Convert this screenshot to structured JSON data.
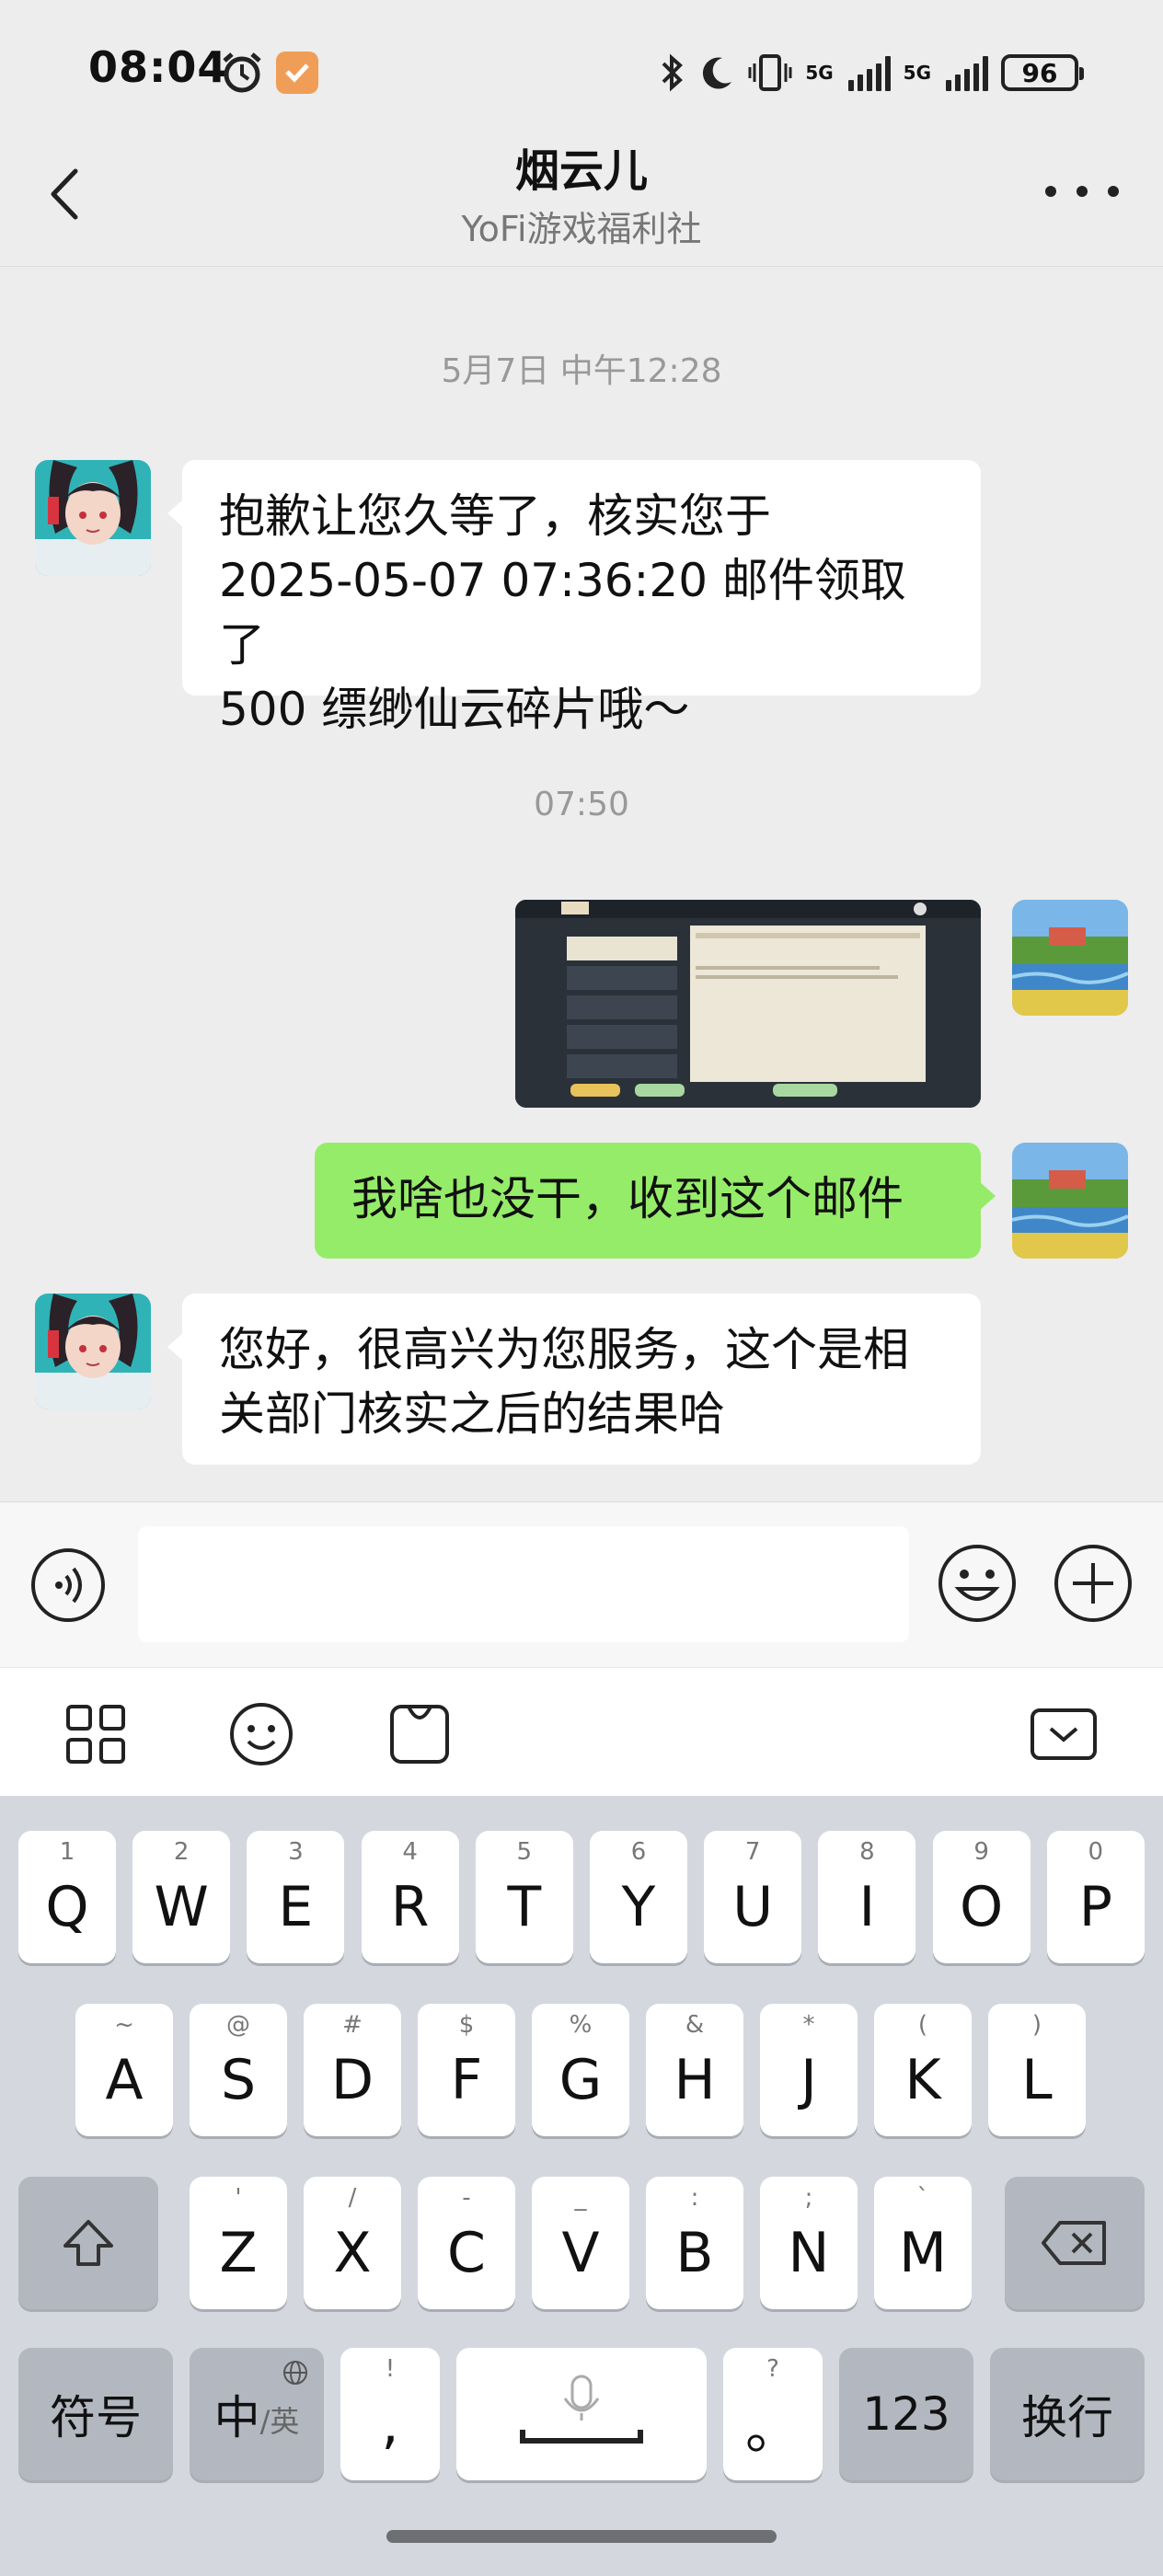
{
  "status_bar": {
    "time": "08:04",
    "network_left": "5G",
    "network_right": "5G",
    "battery": "96"
  },
  "header": {
    "title": "烟云儿",
    "subtitle": "YoFi游戏福利社"
  },
  "messages": {
    "ts1": "5月7日 中午12:28",
    "m1_line1": "抱歉让您久等了，核实您于",
    "m1_line2": "2025-05-07 07:36:20 邮件领取了",
    "m1_line3": "500 缥缈仙云碎片哦～",
    "ts2": "07:50",
    "m3": "我啥也没干，收到这个邮件",
    "m4_line1": "您好，很高兴为您服务，这个是相",
    "m4_line2": "关部门核实之后的结果哈"
  },
  "keyboard": {
    "row1": [
      {
        "hint": "1",
        "key": "Q"
      },
      {
        "hint": "2",
        "key": "W"
      },
      {
        "hint": "3",
        "key": "E"
      },
      {
        "hint": "4",
        "key": "R"
      },
      {
        "hint": "5",
        "key": "T"
      },
      {
        "hint": "6",
        "key": "Y"
      },
      {
        "hint": "7",
        "key": "U"
      },
      {
        "hint": "8",
        "key": "I"
      },
      {
        "hint": "9",
        "key": "O"
      },
      {
        "hint": "0",
        "key": "P"
      }
    ],
    "row2": [
      {
        "hint": "~",
        "key": "A"
      },
      {
        "hint": "@",
        "key": "S"
      },
      {
        "hint": "#",
        "key": "D"
      },
      {
        "hint": "$",
        "key": "F"
      },
      {
        "hint": "%",
        "key": "G"
      },
      {
        "hint": "&",
        "key": "H"
      },
      {
        "hint": "*",
        "key": "J"
      },
      {
        "hint": "(",
        "key": "K"
      },
      {
        "hint": ")",
        "key": "L"
      }
    ],
    "row3": [
      {
        "hint": "'",
        "key": "Z"
      },
      {
        "hint": "/",
        "key": "X"
      },
      {
        "hint": "-",
        "key": "C"
      },
      {
        "hint": "_",
        "key": "V"
      },
      {
        "hint": ":",
        "key": "B"
      },
      {
        "hint": ";",
        "key": "N"
      },
      {
        "hint": "`",
        "key": "M"
      }
    ],
    "symbols": "符号",
    "zh_main": "中",
    "zh_sub": "/英",
    "comma_hint": "!",
    "comma": ",",
    "period_hint": "?",
    "period": "。",
    "num": "123",
    "enter": "换行"
  },
  "colors": {
    "background": "#ededed",
    "sent_bubble": "#95ec69",
    "received_bubble": "#ffffff",
    "keyboard": "#d4d8de"
  }
}
